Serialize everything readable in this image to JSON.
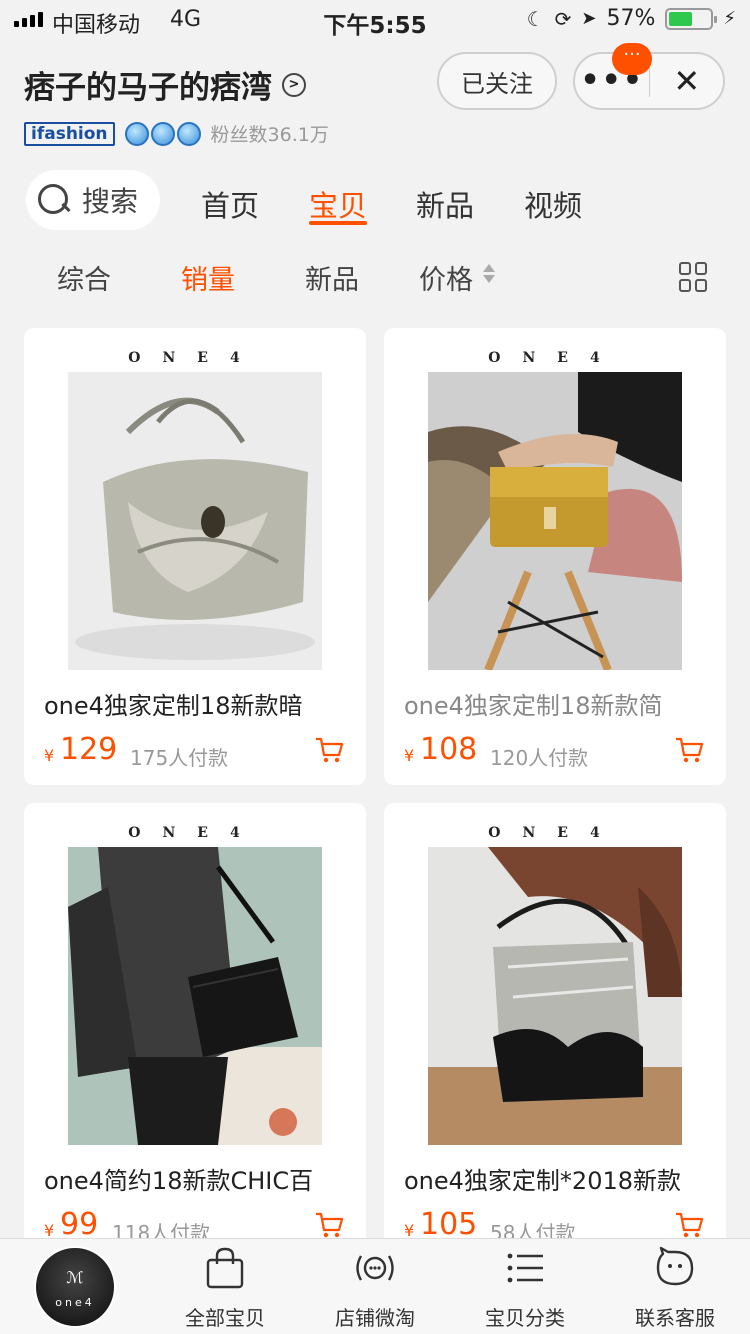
{
  "status_bar": {
    "carrier": "中国移动",
    "network": "4G",
    "time": "下午5:55",
    "battery_percent": "57%",
    "battery_level": 0.57,
    "icons": [
      "moon-icon",
      "rotation-lock-icon",
      "location-icon",
      "charging-icon"
    ]
  },
  "header": {
    "shop_name": "痞子的马子的痞湾",
    "follow_label": "已关注",
    "more_label": "•••",
    "close_label": "✕",
    "badge_label": "···",
    "brand_badge": "ifashion",
    "fans_text": "粉丝数36.1万"
  },
  "nav": {
    "search_label": "搜索",
    "tabs": [
      {
        "label": "首页"
      },
      {
        "label": "宝贝",
        "active": true
      },
      {
        "label": "新品"
      },
      {
        "label": "视频"
      }
    ]
  },
  "sort_bar": {
    "items": [
      {
        "label": "综合"
      },
      {
        "label": "销量",
        "active": true
      },
      {
        "label": "新品"
      },
      {
        "label": "价格"
      }
    ]
  },
  "products": [
    {
      "brand": "ONE4",
      "title": "one4独家定制18新款暗",
      "currency": "¥",
      "price": "129",
      "sold": "175人付款"
    },
    {
      "brand": "ONE4",
      "title": "one4独家定制18新款简",
      "currency": "¥",
      "price": "108",
      "sold": "120人付款"
    },
    {
      "brand": "ONE4",
      "title": "one4简约18新款CHIC百",
      "currency": "¥",
      "price": "99",
      "sold": "118人付款"
    },
    {
      "brand": "ONE4",
      "title": "one4独家定制*2018新款",
      "currency": "¥",
      "price": "105",
      "sold": "58人付款"
    }
  ],
  "tab_bar": {
    "avatar_text": "one4",
    "items": [
      {
        "label": "全部宝贝",
        "icon": "shopping-bag-icon"
      },
      {
        "label": "店铺微淘",
        "icon": "broadcast-icon"
      },
      {
        "label": "宝贝分类",
        "icon": "list-icon"
      },
      {
        "label": "联系客服",
        "icon": "chat-bot-icon"
      }
    ]
  },
  "colors": {
    "accent": "#ff5000",
    "background": "#f2f2f2",
    "brand_blue": "#1a4fa0"
  }
}
